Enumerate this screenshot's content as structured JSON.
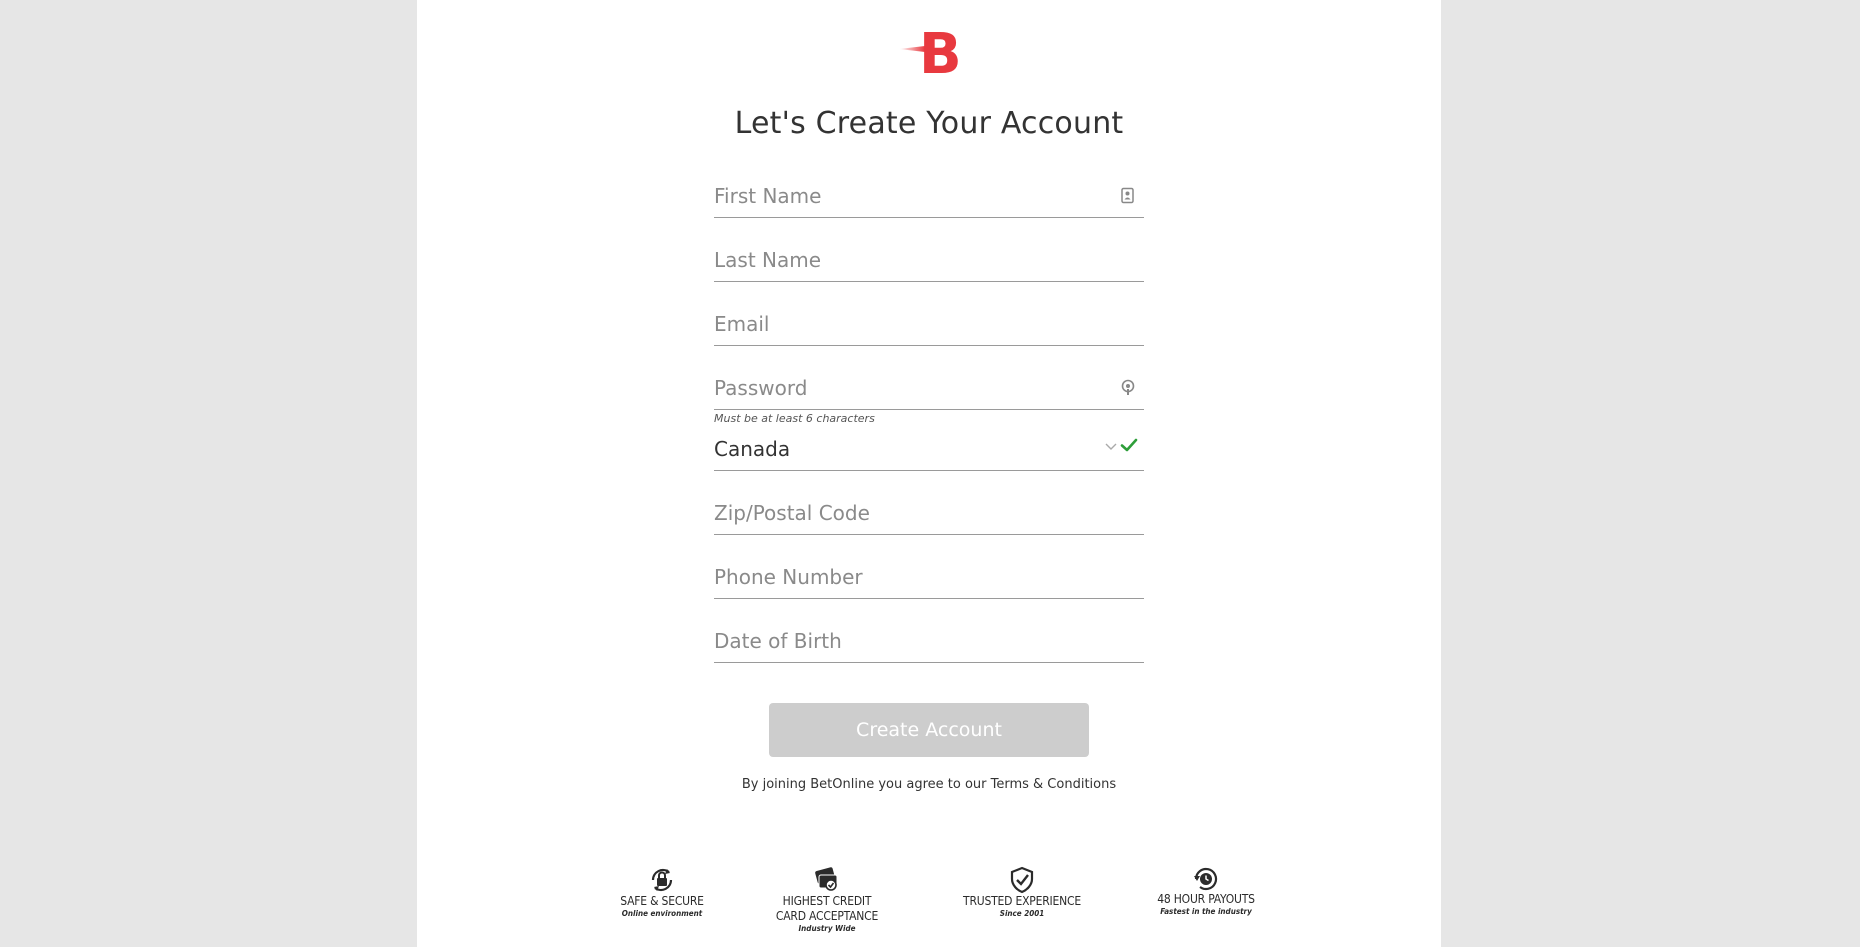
{
  "brand": {
    "logo_letter": "B",
    "accent": "#e8393f"
  },
  "form": {
    "title": "Let's Create Your Account",
    "first_name": {
      "placeholder": "First Name",
      "value": ""
    },
    "last_name": {
      "placeholder": "Last Name",
      "value": ""
    },
    "email": {
      "placeholder": "Email",
      "value": ""
    },
    "password": {
      "placeholder": "Password",
      "value": "",
      "hint": "Must be at least 6 characters"
    },
    "country": {
      "value": "Canada",
      "valid": true
    },
    "zip": {
      "placeholder": "Zip/Postal Code",
      "value": ""
    },
    "phone": {
      "placeholder": "Phone Number",
      "value": ""
    },
    "dob": {
      "placeholder": "Date of Birth",
      "value": ""
    },
    "submit_label": "Create Account",
    "submit_disabled": true,
    "terms_prefix": "By joining BetOnline you agree to our ",
    "terms_link": "Terms & Conditions"
  },
  "badges": [
    {
      "icon": "lock-icon",
      "title_line1": "SAFE & SECURE",
      "title_line2": "",
      "subtitle": "Online environment"
    },
    {
      "icon": "card-icon",
      "title_line1": "HIGHEST CREDIT",
      "title_line2": "CARD ACCEPTANCE",
      "subtitle": "Industry Wide"
    },
    {
      "icon": "shield-check-icon",
      "title_line1": "TRUSTED EXPERIENCE",
      "title_line2": "",
      "subtitle": "Since 2001"
    },
    {
      "icon": "clock-icon",
      "title_line1": "48 HOUR PAYOUTS",
      "title_line2": "",
      "subtitle": "Fastest in the industry"
    }
  ],
  "colors": {
    "check": "#2e9e3a",
    "button_disabled": "#cdcdcd",
    "page_bg": "#e6e6e6"
  }
}
